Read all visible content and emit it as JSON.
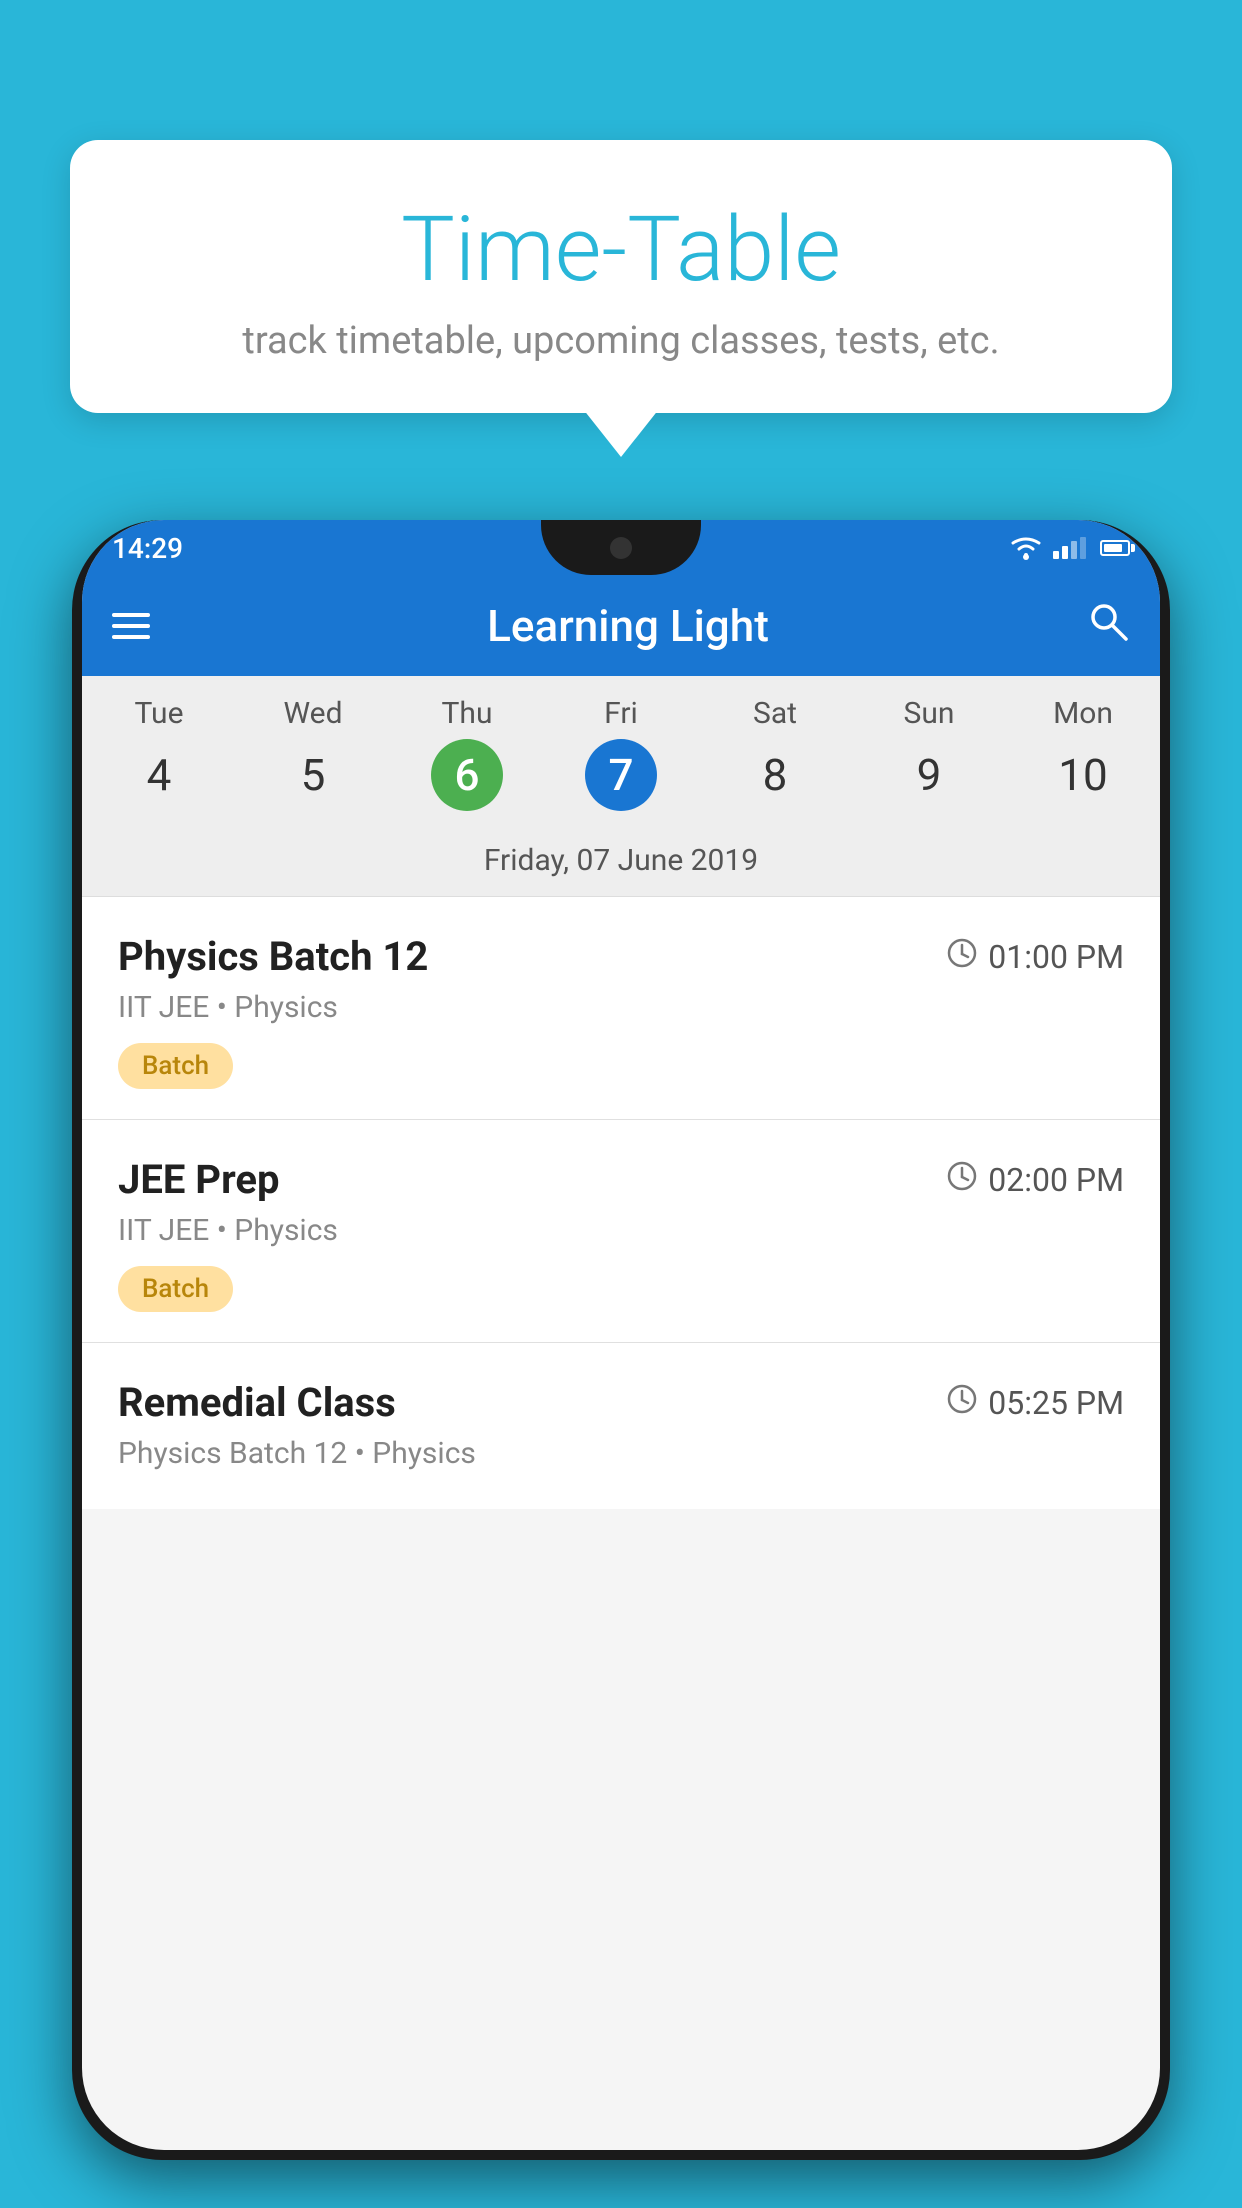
{
  "background_color": "#29B6D8",
  "speech_bubble": {
    "title": "Time-Table",
    "subtitle": "track timetable, upcoming classes, tests, etc."
  },
  "status_bar": {
    "time": "14:29"
  },
  "app_bar": {
    "title": "Learning Light"
  },
  "calendar": {
    "days": [
      {
        "label": "Tue",
        "num": "4"
      },
      {
        "label": "Wed",
        "num": "5"
      },
      {
        "label": "Thu",
        "num": "6",
        "state": "today"
      },
      {
        "label": "Fri",
        "num": "7",
        "state": "selected"
      },
      {
        "label": "Sat",
        "num": "8"
      },
      {
        "label": "Sun",
        "num": "9"
      },
      {
        "label": "Mon",
        "num": "10"
      }
    ],
    "selected_date": "Friday, 07 June 2019"
  },
  "schedule": [
    {
      "title": "Physics Batch 12",
      "time": "01:00 PM",
      "subtitle": "IIT JEE • Physics",
      "badge": "Batch"
    },
    {
      "title": "JEE Prep",
      "time": "02:00 PM",
      "subtitle": "IIT JEE • Physics",
      "badge": "Batch"
    },
    {
      "title": "Remedial Class",
      "time": "05:25 PM",
      "subtitle": "Physics Batch 12 • Physics",
      "badge": null
    }
  ]
}
